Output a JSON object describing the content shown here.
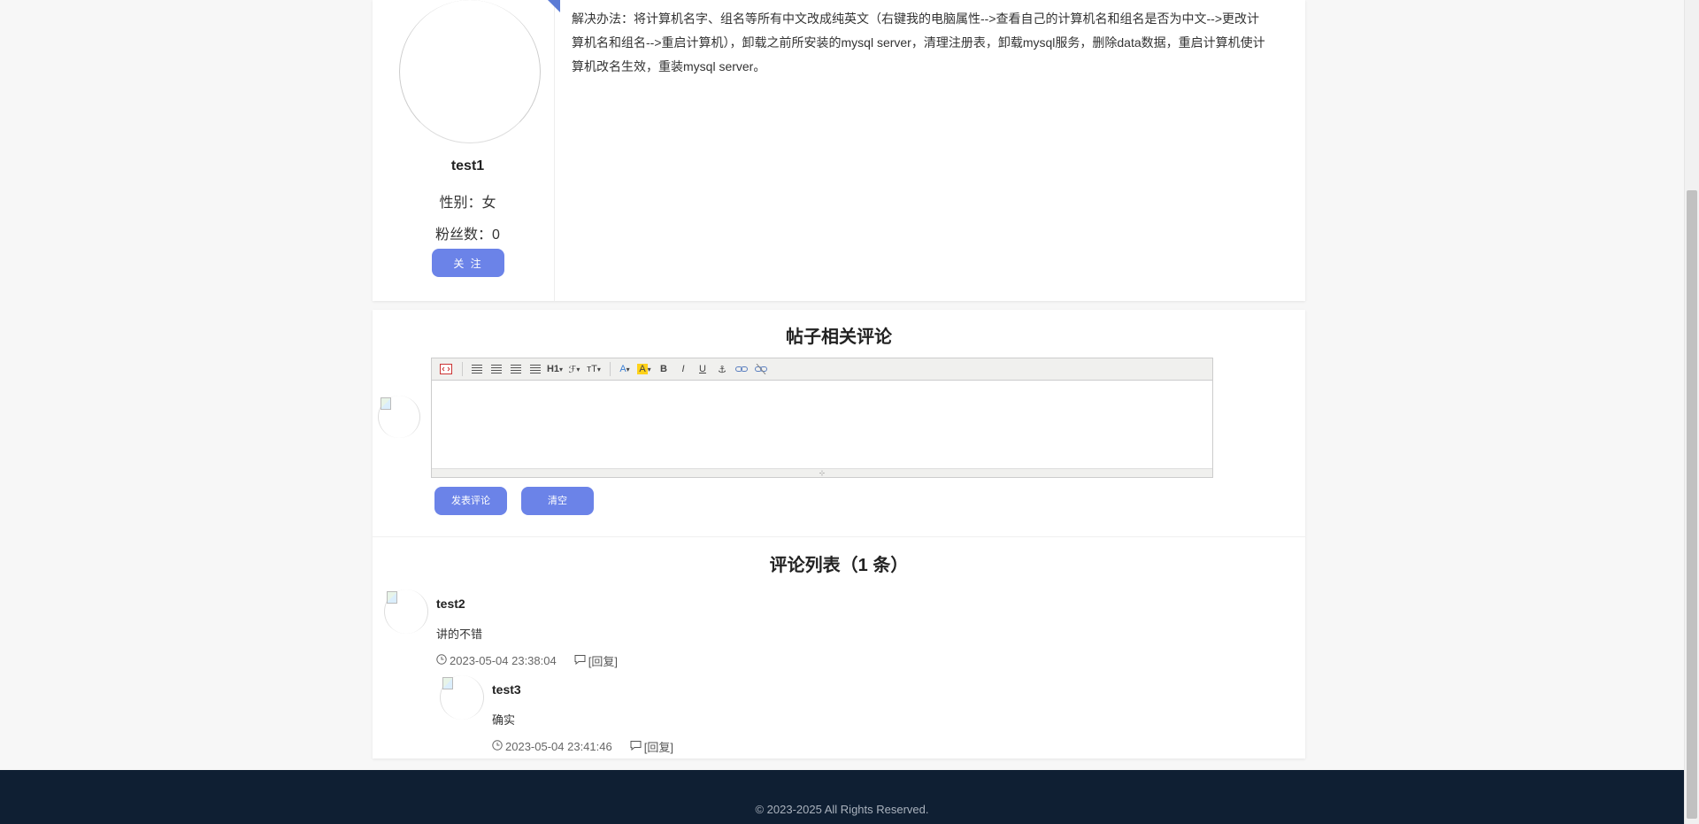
{
  "author": {
    "name": "test1",
    "gender": "性别：女",
    "fans": "粉丝数：0",
    "follow_label": "关 注"
  },
  "post": {
    "content": "解决办法：将计算机名字、组名等所有中文改成纯英文（右键我的电脑属性-->查看自己的计算机名和组名是否为中文-->更改计算机名和组名-->重启计算机），卸载之前所安装的mysql server，清理注册表，卸载mysql服务，删除data数据，重启计算机使计算机改名生效，重装mysql server。"
  },
  "comments_section": {
    "title": "帖子相关评论",
    "submit_label": "发表评论",
    "clear_label": "清空"
  },
  "editor": {
    "toolbar": {
      "heading": "H1",
      "font_family": "ℱ",
      "font_size": "тT",
      "font_color": "A",
      "bg_color": "A",
      "bold": "B",
      "italic": "I",
      "underline": "U"
    },
    "colors": {
      "font": "#3b7fd4",
      "highlight": "#ffd21a"
    }
  },
  "comment_list": {
    "title": "评论列表（1 条）",
    "items": [
      {
        "user": "test2",
        "text": "讲的不错",
        "time": "2023-05-04 23:38:04",
        "reply_label": "[回复]",
        "replies": [
          {
            "user": "test3",
            "text": "确实",
            "time": "2023-05-04 23:41:46",
            "reply_label": "[回复]"
          }
        ]
      }
    ]
  },
  "footer": {
    "copyright": "© 2023-2025 All Rights Reserved."
  },
  "colors": {
    "accent": "#6b83e8",
    "footer_bg": "#0f1f33"
  }
}
